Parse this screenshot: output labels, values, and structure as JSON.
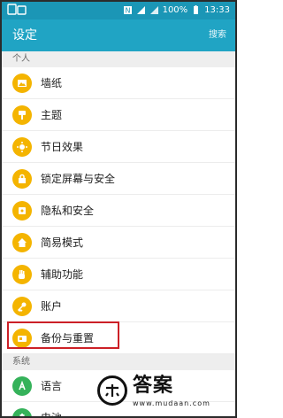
{
  "status_bar": {
    "battery": "100%",
    "time": "13:33"
  },
  "app_bar": {
    "title": "设定",
    "search_label": "搜索"
  },
  "sections": {
    "personal": "个人",
    "system": "系统"
  },
  "items": [
    {
      "label": "墙纸",
      "icon": "wallpaper-icon"
    },
    {
      "label": "主题",
      "icon": "theme-brush-icon"
    },
    {
      "label": "节日效果",
      "icon": "holiday-effect-icon"
    },
    {
      "label": "锁定屏幕与安全",
      "icon": "lock-icon"
    },
    {
      "label": "隐私和安全",
      "icon": "privacy-icon"
    },
    {
      "label": "简易模式",
      "icon": "easy-mode-home-icon"
    },
    {
      "label": "辅助功能",
      "icon": "accessibility-hand-icon"
    },
    {
      "label": "账户",
      "icon": "key-icon"
    },
    {
      "label": "备份与重置",
      "icon": "backup-icon"
    }
  ],
  "system_items": [
    {
      "label": "语言",
      "icon": "language-icon"
    },
    {
      "label": "电池",
      "icon": "battery-icon"
    }
  ],
  "watermark": {
    "text": "答案",
    "url": "www.mudaan.com"
  },
  "colors": {
    "status_bar": "#1b96b6",
    "app_bar": "#20a4c4",
    "icon_amber": "#f4b400",
    "icon_green": "#35b25a",
    "highlight_red": "#cc2027"
  }
}
